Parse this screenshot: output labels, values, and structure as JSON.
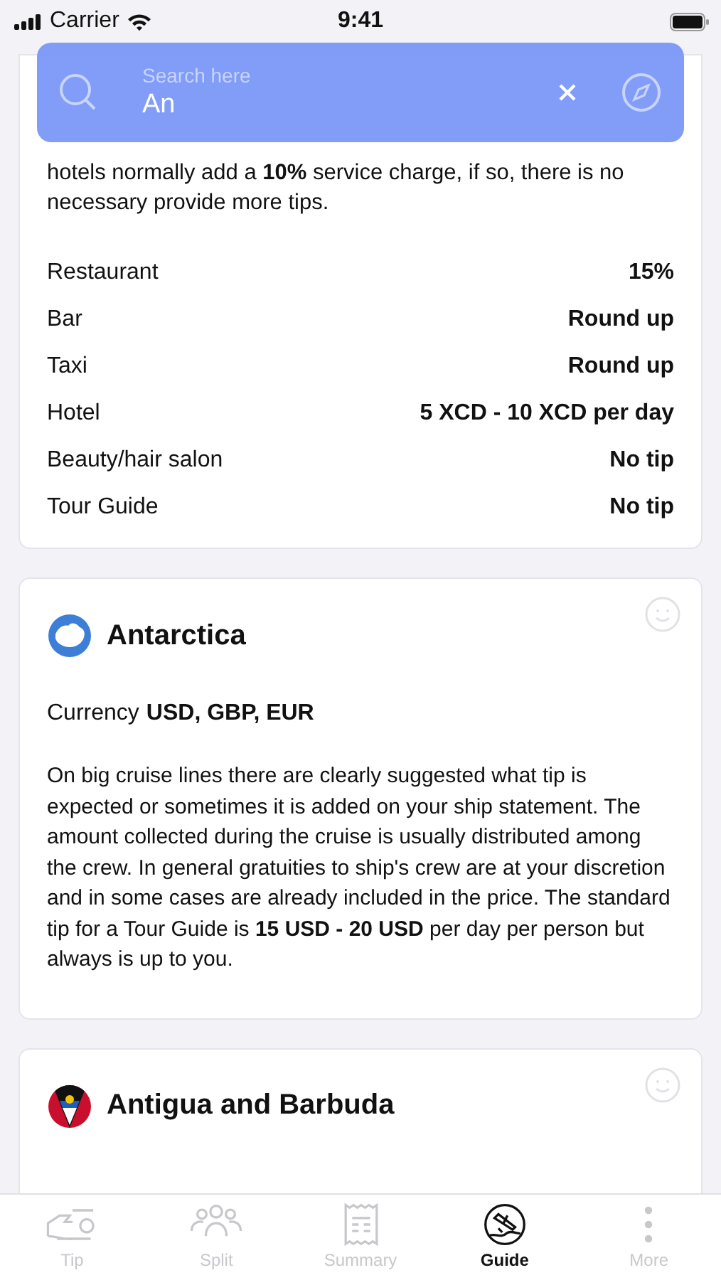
{
  "status_bar": {
    "carrier": "Carrier",
    "time": "9:41"
  },
  "search": {
    "placeholder": "Search here",
    "value": "An"
  },
  "cards": [
    {
      "kind": "tips",
      "description": "hotels normally add a **10%** service charge, if so, there is no necessary provide more tips.",
      "tips": [
        {
          "place": "Restaurant",
          "amount": "15%"
        },
        {
          "place": "Bar",
          "amount": "Round up"
        },
        {
          "place": "Taxi",
          "amount": "Round up"
        },
        {
          "place": "Hotel",
          "amount": "5 XCD - 10 XCD per day"
        },
        {
          "place": "Beauty/hair salon",
          "amount": "No tip"
        },
        {
          "place": "Tour Guide",
          "amount": "No tip"
        }
      ]
    },
    {
      "kind": "country",
      "name": "Antarctica",
      "currency_label": "Currency",
      "currency": "USD, GBP, EUR",
      "description": "On big cruise lines there are clearly suggested what tip is expected or sometimes it is added on your ship statement. The amount collected during the cruise is usually distributed among the crew. In general gratuities to ship's crew are at your discretion and in some cases are already included in the price. The standard tip for a Tour Guide is **15 USD - 20 USD** per day per person but always is up to you."
    },
    {
      "kind": "country",
      "name": "Antigua and Barbuda"
    }
  ],
  "tabs": [
    {
      "label": "Tip",
      "selected": false
    },
    {
      "label": "Split",
      "selected": false
    },
    {
      "label": "Summary",
      "selected": false
    },
    {
      "label": "Guide",
      "selected": true
    },
    {
      "label": "More",
      "selected": false
    }
  ]
}
